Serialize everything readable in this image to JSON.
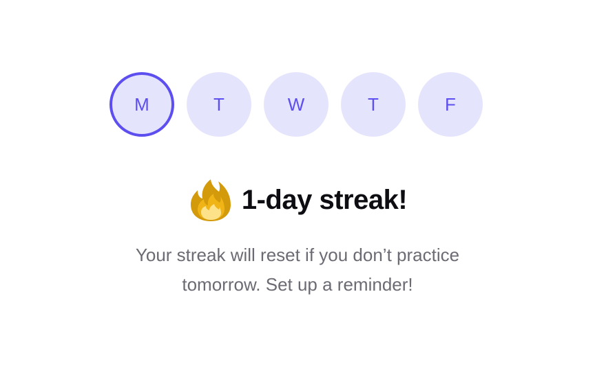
{
  "days": [
    {
      "label": "M",
      "active": true
    },
    {
      "label": "T",
      "active": false
    },
    {
      "label": "W",
      "active": false
    },
    {
      "label": "T",
      "active": false
    },
    {
      "label": "F",
      "active": false
    }
  ],
  "streak": {
    "icon": "fire-icon",
    "title": "1-day streak!"
  },
  "message": {
    "line1": "Your streak will reset if you don’t practice",
    "line2": "tomorrow. Set up a reminder!"
  },
  "colors": {
    "accent": "#5d4ef0",
    "day_bg": "#e5e4fd",
    "title": "#0d0d12",
    "body_text": "#6b6b73"
  }
}
